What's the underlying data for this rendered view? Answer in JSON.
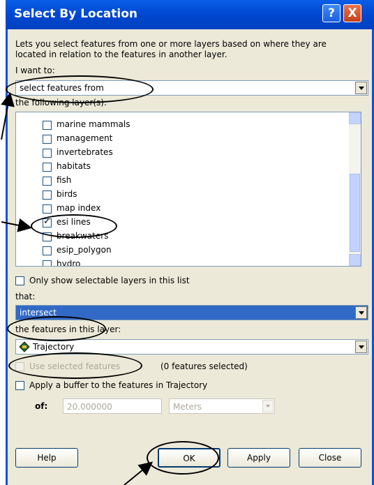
{
  "window": {
    "title": "Select By Location"
  },
  "titlebar_buttons": {
    "help": "?",
    "close": "X"
  },
  "description": "Lets you select features from one or more layers based on where they are located in relation to the features in another layer.",
  "i_want_to": {
    "label": "I want to:",
    "value": "select features from"
  },
  "layers": {
    "label": "the following layer(s):",
    "items": [
      {
        "name": "marine mammals",
        "checked": false
      },
      {
        "name": "management",
        "checked": false
      },
      {
        "name": "invertebrates",
        "checked": false
      },
      {
        "name": "habitats",
        "checked": false
      },
      {
        "name": "fish",
        "checked": false
      },
      {
        "name": "birds",
        "checked": false
      },
      {
        "name": "map index",
        "checked": false
      },
      {
        "name": "esi lines",
        "checked": true
      },
      {
        "name": "breakwaters",
        "checked": false
      },
      {
        "name": "esip_polygon",
        "checked": false
      },
      {
        "name": "hydro",
        "checked": false
      }
    ]
  },
  "only_selectable": {
    "label": "Only show selectable layers in this list"
  },
  "that": {
    "label": "that:",
    "value": "intersect"
  },
  "features_layer": {
    "label": "the features in this layer:",
    "value": "Trajectory"
  },
  "use_selected": {
    "label": "Use selected features",
    "count_text": "(0 features selected)"
  },
  "buffer": {
    "label": "Apply a buffer to the features in Trajectory",
    "of_label": "of:",
    "distance": "20.000000",
    "units": "Meters"
  },
  "buttons": {
    "help": "Help",
    "ok": "OK",
    "apply": "Apply",
    "close": "Close"
  },
  "colors": {
    "titlebar": "#0047cf",
    "selection": "#3169c6",
    "dialog_bg": "#ece9d8"
  }
}
